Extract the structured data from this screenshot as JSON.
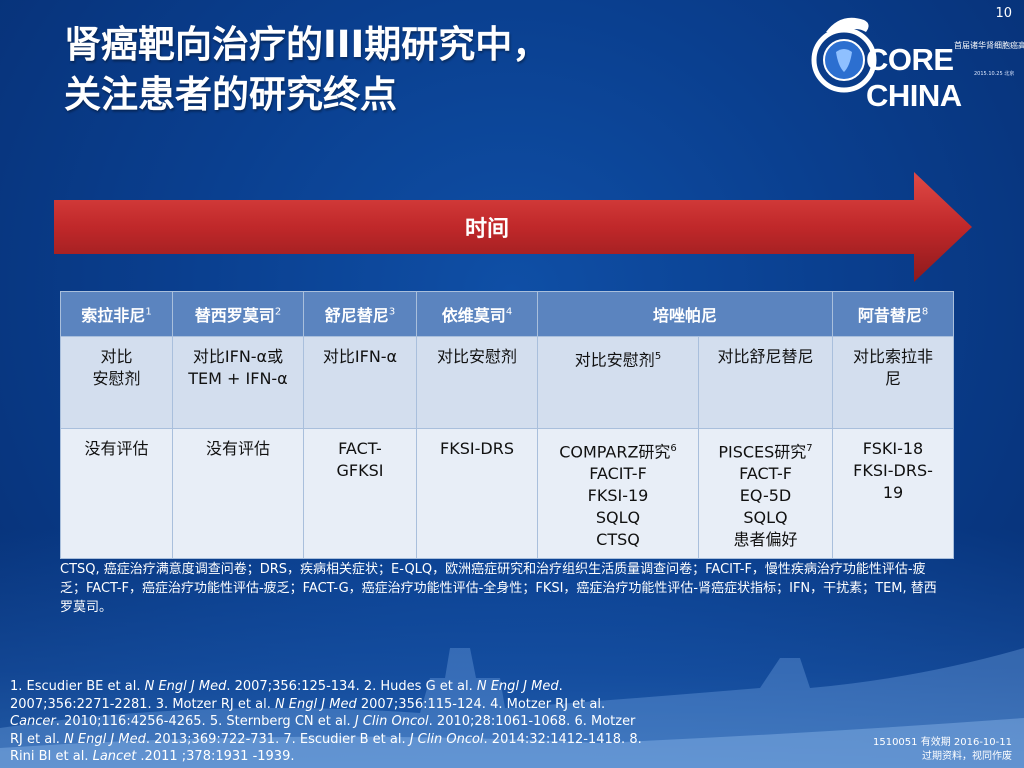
{
  "page_number": "10",
  "logo": {
    "text": "CORE CHINA",
    "subtitle": "首届诸华肾细胞癌高峰论坛",
    "date": "2015.10.25 北京"
  },
  "title": {
    "line1": "肾癌靶向治疗的III期研究中，",
    "line2": "关注患者的研究终点"
  },
  "timeline": {
    "label": "时间"
  },
  "table": {
    "headers": [
      {
        "label": "索拉非尼",
        "sup": "1"
      },
      {
        "label": "替西罗莫司",
        "sup": "2"
      },
      {
        "label": "舒尼替尼",
        "sup": "3"
      },
      {
        "label": "依维莫司",
        "sup": "4"
      },
      {
        "label": "培唑帕尼",
        "sup": ""
      },
      {
        "label": "阿昔替尼",
        "sup": "8"
      }
    ],
    "compare_row": [
      {
        "lines": [
          "对比",
          "安慰剂"
        ],
        "sup": ""
      },
      {
        "lines": [
          "对比IFN-α或",
          "TEM + IFN-α"
        ],
        "sup": ""
      },
      {
        "lines": [
          "对比IFN-α"
        ],
        "sup": ""
      },
      {
        "lines": [
          "对比安慰剂"
        ],
        "sup": ""
      },
      {
        "lines": [
          "对比安慰剂"
        ],
        "sup": "5"
      },
      {
        "lines": [
          "对比舒尼替尼"
        ],
        "sup": ""
      },
      {
        "lines": [
          "对比索拉非",
          "尼"
        ],
        "sup": ""
      }
    ],
    "tools_row": [
      {
        "lines": [
          "没有评估"
        ],
        "sup": ""
      },
      {
        "lines": [
          "没有评估"
        ],
        "sup": ""
      },
      {
        "lines": [
          "FACT-",
          "GFKSI"
        ],
        "sup": ""
      },
      {
        "lines": [
          "FKSI-DRS"
        ],
        "sup": ""
      },
      {
        "lines": [
          "COMPARZ研究",
          "FACIT-F",
          "FKSI-19",
          "SQLQ",
          "CTSQ"
        ],
        "sup": "6"
      },
      {
        "lines": [
          "PISCES研究",
          "FACT-F",
          "EQ-5D",
          "SQLQ",
          "患者偏好"
        ],
        "sup": "7"
      },
      {
        "lines": [
          "FSKI-18",
          "FKSI-DRS-",
          "19"
        ],
        "sup": ""
      }
    ]
  },
  "abbreviations": "CTSQ, 癌症治疗满意度调查问卷；DRS，疾病相关症状；E-QLQ，欧洲癌症研究和治疗组织生活质量调查问卷；FACIT-F，慢性疾病治疗功能性评估-疲乏；FACT-F，癌症治疗功能性评估-疲乏；FACT-G，癌症治疗功能性评估-全身性；FKSI，癌症治疗功能性评估-肾癌症状指标；IFN，干扰素；TEM, 替西罗莫司。",
  "references": [
    {
      "pre": "1. Escudier BE et al. ",
      "journal": "N Engl J Med",
      "post": ". 2007;356:125-134. "
    },
    {
      "pre": "2. Hudes G et al. ",
      "journal": "N Engl J Med",
      "post": ". 2007;356:2271-2281. "
    },
    {
      "pre": "3. Motzer RJ et al. ",
      "journal": "N Engl J Med",
      "post": " 2007;356:115-124. "
    },
    {
      "pre": "4. Motzer RJ et al. ",
      "journal": "Cancer",
      "post": ". 2010;116:4256-4265. "
    },
    {
      "pre": "5. Sternberg CN et al. ",
      "journal": "J Clin Oncol",
      "post": ". 2010;28:1061-1068. "
    },
    {
      "pre": "6. Motzer RJ et al. ",
      "journal": "N Engl J Med",
      "post": ". 2013;369:722-731. "
    },
    {
      "pre": "7. Escudier B et al. ",
      "journal": "J Clin Oncol",
      "post": ". 2014:32:1412-1418. "
    },
    {
      "pre": "8. Rini BI et al. ",
      "journal": "Lancet",
      "post": " .2011 ;378:1931 -1939."
    }
  ],
  "footer": {
    "code_line": "1510051  有效期 2016-10-11",
    "note_line": "过期资料，视同作废"
  },
  "colors": {
    "background": "#0a3f8f",
    "arrow_red": "#c0282a",
    "table_header": "#5b84bf",
    "table_row1": "#d3deee",
    "table_row2": "#e8eef7"
  }
}
